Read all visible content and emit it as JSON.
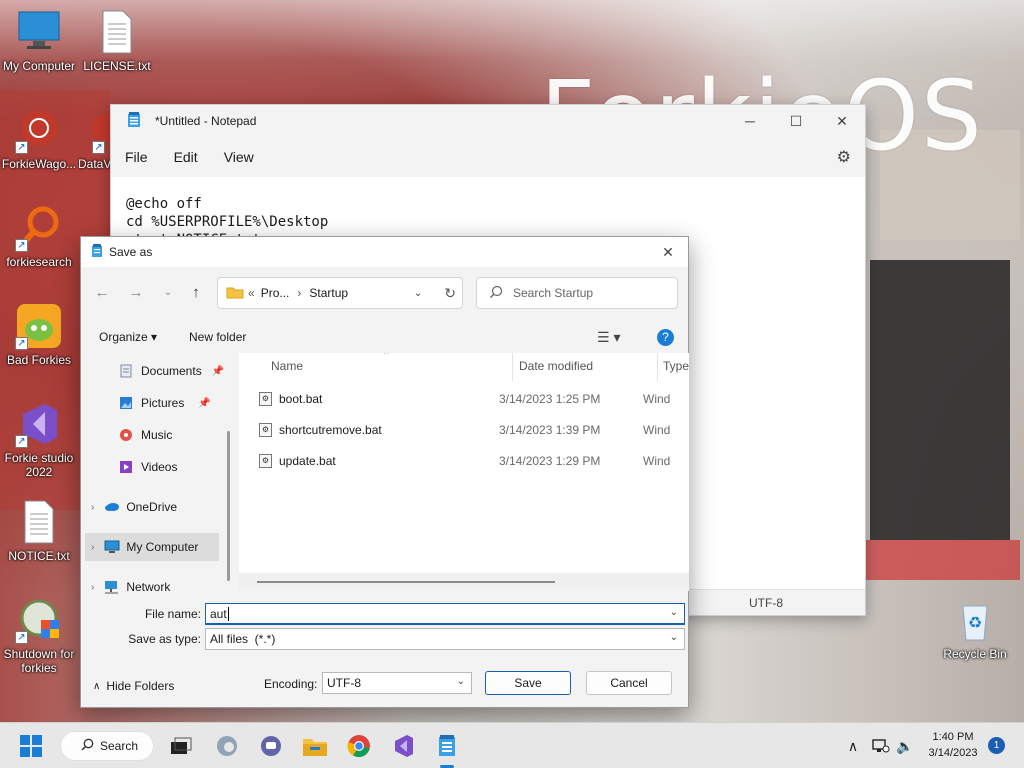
{
  "desktop": {
    "wallpaper_text": "ForkieOS",
    "icons": [
      {
        "label": "My Computer"
      },
      {
        "label": "LICENSE.txt"
      },
      {
        "label": "ForkieWago..."
      },
      {
        "label": "DataV..."
      },
      {
        "label": "forkiesearch"
      },
      {
        "label": "Bad Forkies"
      },
      {
        "label": "Forkie studio 2022"
      },
      {
        "label": "NOTICE.txt"
      },
      {
        "label": "Shutdown for forkies"
      },
      {
        "label": "Recycle Bin"
      }
    ]
  },
  "notepad": {
    "title": "*Untitled - Notepad",
    "menu": [
      "File",
      "Edit",
      "View"
    ],
    "content": "@echo off\ncd %USERPROFILE%\\Desktop\nstart NOTICE.txt",
    "encoding": "UTF-8"
  },
  "dialog": {
    "title": "Save as",
    "address": {
      "prefix": "«",
      "crumb1": "Pro...",
      "sep": "›",
      "crumb2": "Startup"
    },
    "search_placeholder": "Search Startup",
    "toolbar": {
      "organize": "Organize ▾",
      "new_folder": "New folder"
    },
    "nav": [
      {
        "label": "Documents"
      },
      {
        "label": "Pictures"
      },
      {
        "label": "Music"
      },
      {
        "label": "Videos"
      },
      {
        "label": "OneDrive"
      },
      {
        "label": "My Computer"
      },
      {
        "label": "Network"
      }
    ],
    "columns": {
      "name": "Name",
      "date": "Date modified",
      "type": "Type"
    },
    "files": [
      {
        "name": "boot.bat",
        "date": "3/14/2023 1:25 PM",
        "type": "Wind"
      },
      {
        "name": "shortcutremove.bat",
        "date": "3/14/2023 1:39 PM",
        "type": "Wind"
      },
      {
        "name": "update.bat",
        "date": "3/14/2023 1:29 PM",
        "type": "Wind"
      }
    ],
    "file_name_label": "File name:",
    "file_name_value": "aut",
    "save_type_label": "Save as type:",
    "save_type_value": "All files  (*.*)",
    "hide_folders": "Hide Folders",
    "encoding_label": "Encoding:",
    "encoding_value": "UTF-8",
    "save": "Save",
    "cancel": "Cancel"
  },
  "taskbar": {
    "search": "Search",
    "time": "1:40 PM",
    "date": "3/14/2023",
    "notifications": "1"
  },
  "colors": {
    "accent": "#1a5fb4",
    "primary_button_border": "#1a5fb4"
  }
}
